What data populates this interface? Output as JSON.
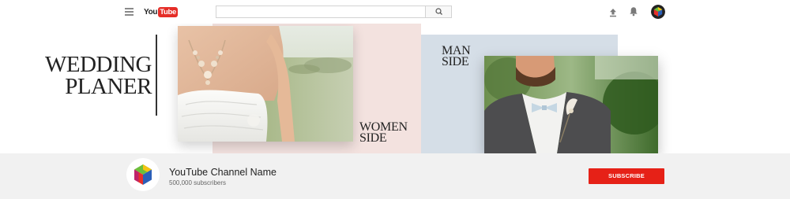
{
  "header": {
    "logo_you": "You",
    "logo_tube": "Tube",
    "search_placeholder": ""
  },
  "banner": {
    "title_line1": "WEDDING",
    "title_line2": "PLANER",
    "women_line1": "WOMEN",
    "women_line2": "SIDE",
    "man_line1": "MAN",
    "man_line2": "SIDE"
  },
  "channel": {
    "name": "YouTube Channel Name",
    "subscribers": "500,000 subscribers",
    "subscribe_label": "SUBSCRIBE"
  },
  "colors": {
    "accent_red": "#e62117",
    "pink_panel": "#f3e2df",
    "blue_panel": "#d5dee7"
  }
}
